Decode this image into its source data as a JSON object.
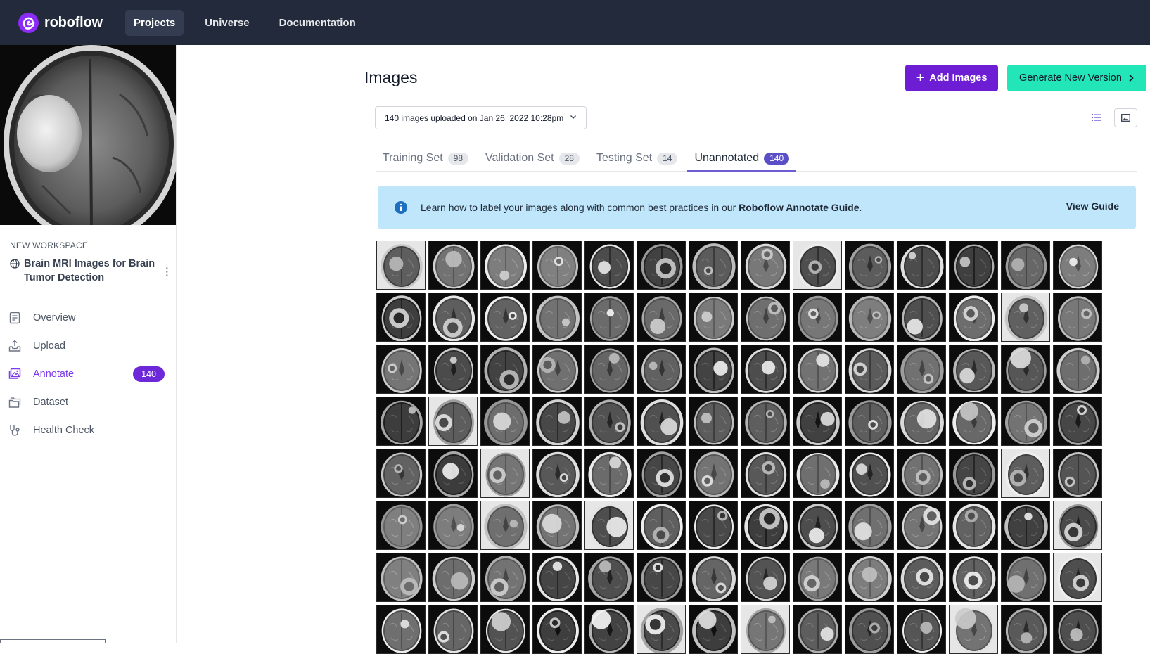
{
  "nav": {
    "brand": "roboflow",
    "items": [
      {
        "label": "Projects",
        "active": true
      },
      {
        "label": "Universe",
        "active": false
      },
      {
        "label": "Documentation",
        "active": false
      }
    ]
  },
  "sidebar": {
    "workspace": "NEW WORKSPACE",
    "project_name": "Brain MRI Images for Brain Tumor Detection",
    "menu": [
      {
        "label": "Overview",
        "icon": "document-icon"
      },
      {
        "label": "Upload",
        "icon": "upload-icon"
      },
      {
        "label": "Annotate",
        "icon": "images-icon",
        "badge": "140",
        "active": true
      },
      {
        "label": "Dataset",
        "icon": "folder-icon"
      },
      {
        "label": "Health Check",
        "icon": "stethoscope-icon"
      }
    ]
  },
  "main": {
    "title": "Images",
    "add_button": "Add Images",
    "generate_button": "Generate New Version",
    "upload_select": "140 images uploaded on Jan 26, 2022 10:28pm",
    "tabs": [
      {
        "label": "Training Set",
        "count": "98"
      },
      {
        "label": "Validation Set",
        "count": "28"
      },
      {
        "label": "Testing Set",
        "count": "14"
      },
      {
        "label": "Unannotated",
        "count": "140",
        "active": true
      }
    ],
    "banner": {
      "text_before": "Learn how to label your images along with common best practices in our ",
      "text_bold": "Roboflow Annotate Guide",
      "text_after": ".",
      "link": "View Guide"
    }
  },
  "colors": {
    "nav_bg": "#232a3b",
    "accent_purple": "#6d1ed4",
    "accent_teal": "#22e5b8",
    "banner_bg": "#bfe6fb",
    "tab_indicator": "#6d5dd3"
  }
}
